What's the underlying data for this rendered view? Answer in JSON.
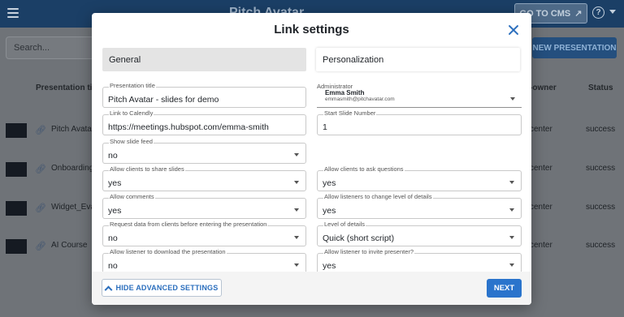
{
  "background": {
    "app_title": "Pitch Avatar",
    "cms_button": "GO TO CMS",
    "cms_icon": "external-link-icon",
    "help_icon": "?",
    "search_placeholder": "Search...",
    "new_presentation_button": "NEW PRESENTATION",
    "columns": {
      "title": "Presentation title",
      "owner": "-owner",
      "status": "Status"
    },
    "rows": [
      {
        "name": "Pitch Avatar",
        "owner": "center",
        "status": "success"
      },
      {
        "name": "Onboarding",
        "owner": "center",
        "status": "success"
      },
      {
        "name": "Widget_Eva",
        "owner": "center",
        "status": "success"
      },
      {
        "name": "AI Course",
        "owner": "center",
        "status": "success"
      }
    ]
  },
  "modal": {
    "title": "Link settings",
    "tabs": [
      "General",
      "Personalization"
    ],
    "fields": {
      "presentation_title": {
        "label": "Presentation title",
        "value": "Pitch Avatar - slides for demo"
      },
      "administrator": {
        "label": "Administrator",
        "name": "Emma Smith",
        "email": "emmasmith@pitchavatar.com"
      },
      "calendly": {
        "label": "Link to Calendly",
        "value": "https://meetings.hubspot.com/emma-smith"
      },
      "start_slide": {
        "label": "Start Slide Number",
        "value": "1"
      },
      "slide_feed": {
        "label": "Show slide feed",
        "value": "no"
      },
      "share_slides": {
        "label": "Allow clients to share slides",
        "value": "yes"
      },
      "ask_questions": {
        "label": "Allow clients to ask questions",
        "value": "yes"
      },
      "comments": {
        "label": "Allow comments",
        "value": "yes"
      },
      "change_level": {
        "label": "Allow listeners to change level of details",
        "value": "yes"
      },
      "request_data": {
        "label": "Request data from clients before entering the presentation",
        "value": "no"
      },
      "level_details": {
        "label": "Level of details",
        "value": "Quick (short script)"
      },
      "download": {
        "label": "Allow listener to download the presentation",
        "value": "no"
      },
      "invite_presenter": {
        "label": "Allow listener to invite presenter?",
        "value": "yes"
      }
    },
    "footer": {
      "hide_advanced": "HIDE ADVANCED SETTINGS",
      "next": "NEXT"
    }
  },
  "colors": {
    "accent": "#2a74cc",
    "topbar": "#1b3f66",
    "overlay": "#6f7378"
  }
}
